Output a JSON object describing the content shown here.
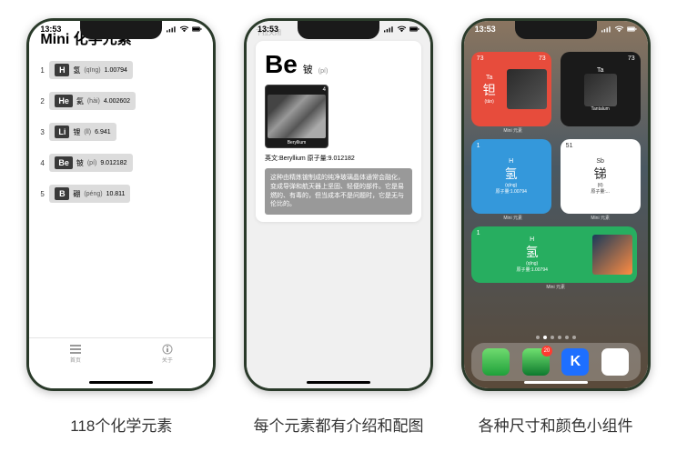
{
  "status": {
    "time": "13:53"
  },
  "s1": {
    "title": "Mini 化学元素",
    "rows": [
      {
        "n": "1",
        "sym": "H",
        "cn": "氢",
        "py": "(qīng)",
        "mass": "1.00794"
      },
      {
        "n": "2",
        "sym": "He",
        "cn": "氦",
        "py": "(hài)",
        "mass": "4.002602"
      },
      {
        "n": "3",
        "sym": "Li",
        "cn": "锂",
        "py": "(lǐ)",
        "mass": "6.941"
      },
      {
        "n": "4",
        "sym": "Be",
        "cn": "铍",
        "py": "(pí)",
        "mass": "9.012182"
      },
      {
        "n": "5",
        "sym": "B",
        "cn": "硼",
        "py": "(péng)",
        "mass": "10.811"
      }
    ],
    "tab1": "首页",
    "tab2": "关于"
  },
  "s2": {
    "pull": "下拉关闭",
    "sym": "Be",
    "cn": "铍",
    "py": "(pí)",
    "num": "4",
    "en": "Beryllium",
    "info": "英文:Beryllium 原子量:9.012182",
    "desc": "这种由精炼铍制成的纯净玻璃晶体通常会融化，变成导弹和航天器上坚固、轻便的部件。它是易燃的、有毒的，但当成本不是问题时，它是无与伦比的。"
  },
  "s3": {
    "w1": {
      "num": "73",
      "sym": "Ta",
      "cn": "钽",
      "py": "(tǎn)",
      "en": "Tantalum",
      "lbl": "Mini 元素"
    },
    "w2": {
      "num": "1",
      "sym": "H",
      "cn": "氢",
      "py": "(qīng)",
      "mass": "原子量:1.00794",
      "lbl": "Mini 元素"
    },
    "w3": {
      "num": "51",
      "sym": "Sb",
      "cn": "锑",
      "py": "(tī)",
      "mass": "原子量:...",
      "lbl": "Mini 元素"
    },
    "w4": {
      "num": "1",
      "sym": "H",
      "cn": "氢",
      "py": "(qīng)",
      "mass": "原子量:1.00794",
      "lbl": "Mini 元素"
    },
    "badge": "20"
  },
  "captions": [
    "118个化学元素",
    "每个元素都有介绍和配图",
    "各种尺寸和颜色小组件"
  ]
}
